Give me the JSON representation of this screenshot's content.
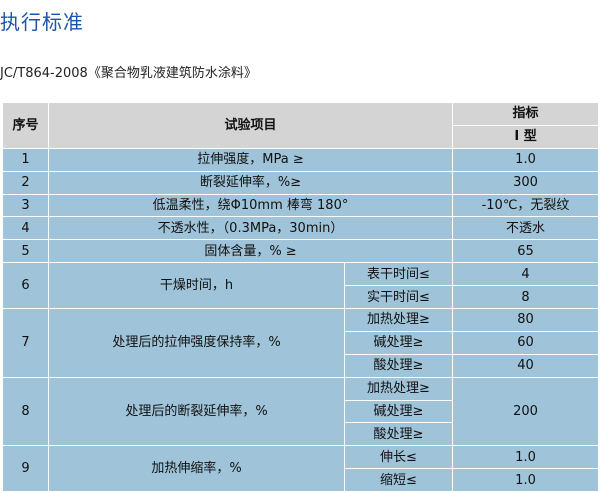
{
  "title": "执行标准",
  "subtitle": "JC/T864-2008《聚合物乳液建筑防水涂料》",
  "table": {
    "headers": {
      "no": "序号",
      "item": "试验项目",
      "index": "指标",
      "grade": "I 型"
    },
    "rows": {
      "r1": {
        "no": "1",
        "item": "拉伸强度，MPa ≥",
        "value": "1.0"
      },
      "r2": {
        "no": "2",
        "item": "断裂延伸率，%≥",
        "value": "300"
      },
      "r3": {
        "no": "3",
        "item": "低温柔性，绕Φ10mm 棒弯 180°",
        "value": "-10℃，无裂纹"
      },
      "r4": {
        "no": "4",
        "item": "不透水性，（0.3MPa，30min）",
        "value": "不透水"
      },
      "r5": {
        "no": "5",
        "item": "固体含量，% ≥",
        "value": "65"
      },
      "r6": {
        "no": "6",
        "item": "干燥时间，h",
        "subs": [
          {
            "label": "表干时间≤",
            "value": "4"
          },
          {
            "label": "实干时间≤",
            "value": "8"
          }
        ]
      },
      "r7": {
        "no": "7",
        "item": "处理后的拉伸强度保持率，%",
        "subs": [
          {
            "label": "加热处理≥",
            "value": "80"
          },
          {
            "label": "碱处理≥",
            "value": "60"
          },
          {
            "label": "酸处理≥",
            "value": "40"
          }
        ]
      },
      "r8": {
        "no": "8",
        "item": "处理后的断裂延伸率，%",
        "value": "200",
        "subs": [
          {
            "label": "加热处理≥"
          },
          {
            "label": "碱处理≥"
          },
          {
            "label": "酸处理≥"
          }
        ]
      },
      "r9": {
        "no": "9",
        "item": "加热伸缩率，%",
        "subs": [
          {
            "label": "伸长≤",
            "value": "1.0"
          },
          {
            "label": "缩短≤",
            "value": "1.0"
          }
        ]
      }
    }
  }
}
